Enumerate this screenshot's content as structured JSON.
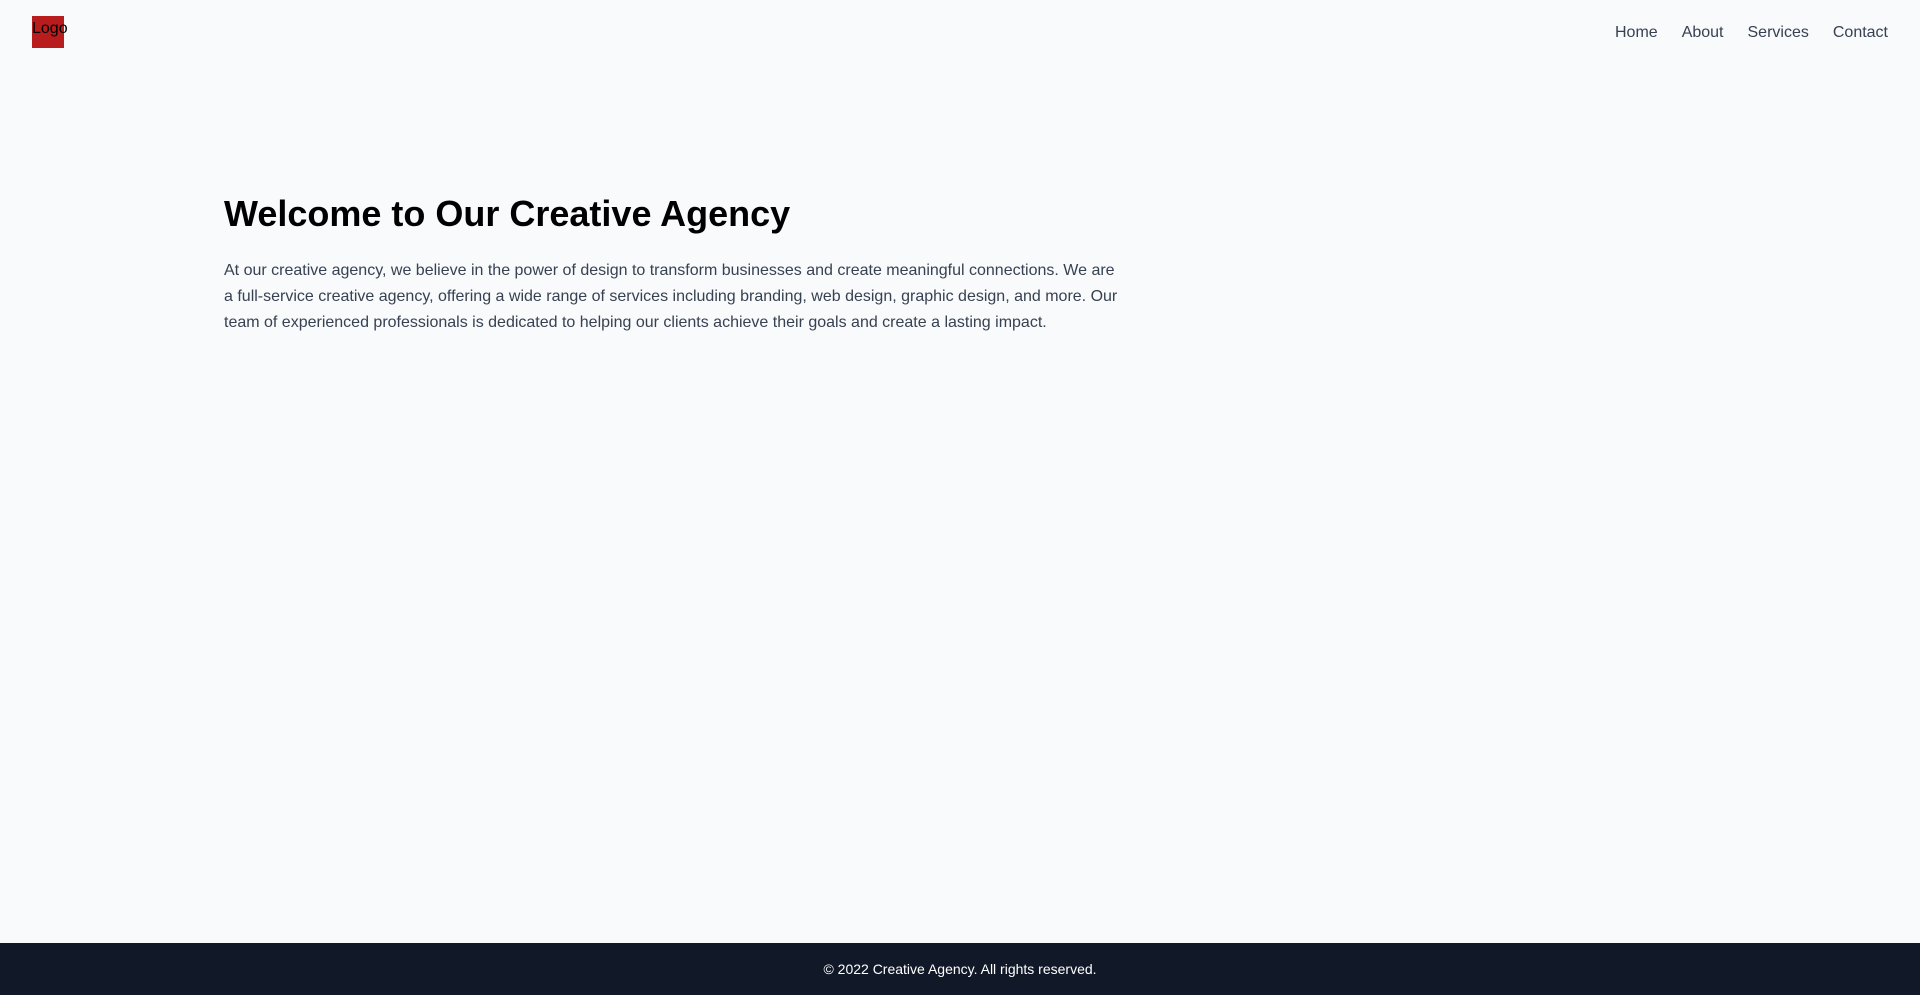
{
  "header": {
    "logo_text": "Logo",
    "nav": [
      {
        "label": "Home"
      },
      {
        "label": "About"
      },
      {
        "label": "Services"
      },
      {
        "label": "Contact"
      }
    ]
  },
  "hero": {
    "title": "Welcome to Our Creative Agency",
    "body": "At our creative agency, we believe in the power of design to transform businesses and create meaningful connections. We are a full-service creative agency, offering a wide range of services including branding, web design, graphic design, and more. Our team of experienced professionals is dedicated to helping our clients achieve their goals and create a lasting impact."
  },
  "footer": {
    "copyright": "© 2022 Creative Agency. All rights reserved."
  },
  "colors": {
    "background": "#f8fafc",
    "logo": "#b91c1c",
    "footer": "#111827",
    "nav_text": "#374151"
  }
}
